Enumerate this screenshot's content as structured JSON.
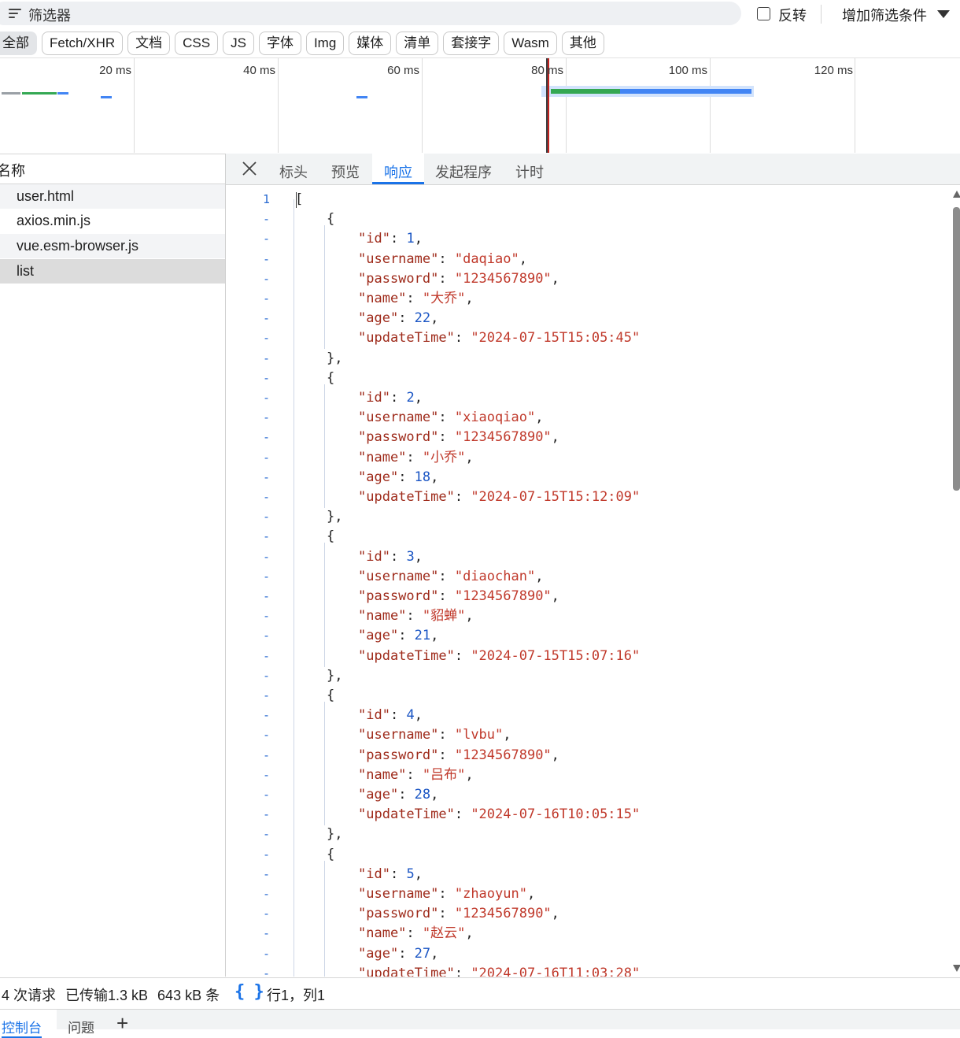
{
  "filter": {
    "placeholder": "筛选器",
    "invert_label": "反转",
    "add_filter_label": "增加筛选条件"
  },
  "type_chips": [
    "全部",
    "Fetch/XHR",
    "文档",
    "CSS",
    "JS",
    "字体",
    "Img",
    "媒体",
    "清单",
    "套接字",
    "Wasm",
    "其他"
  ],
  "timeline": {
    "ticks": [
      "20 ms",
      "40 ms",
      "60 ms",
      "80 ms",
      "100 ms",
      "120 ms"
    ],
    "colors": {
      "waiting": "#34a853",
      "download": "#4285f4",
      "queued": "#9aa0a6",
      "marker": "#c5221f"
    }
  },
  "requests": {
    "header": "名称",
    "items": [
      "user.html",
      "axios.min.js",
      "vue.esm-browser.js",
      "list"
    ],
    "selected": "list"
  },
  "detail_tabs": {
    "items": [
      "标头",
      "预览",
      "响应",
      "发起程序",
      "计时"
    ],
    "active": "响应"
  },
  "response": {
    "first_line_number": "1",
    "other_line_marker": "-",
    "records": [
      {
        "id": 1,
        "username": "daqiao",
        "password": "1234567890",
        "name": "大乔",
        "age": 22,
        "updateTime": "2024-07-15T15:05:45"
      },
      {
        "id": 2,
        "username": "xiaoqiao",
        "password": "1234567890",
        "name": "小乔",
        "age": 18,
        "updateTime": "2024-07-15T15:12:09"
      },
      {
        "id": 3,
        "username": "diaochan",
        "password": "1234567890",
        "name": "貂蝉",
        "age": 21,
        "updateTime": "2024-07-15T15:07:16"
      },
      {
        "id": 4,
        "username": "lvbu",
        "password": "1234567890",
        "name": "吕布",
        "age": 28,
        "updateTime": "2024-07-16T10:05:15"
      },
      {
        "id": 5,
        "username": "zhaoyun",
        "password": "1234567890",
        "name": "赵云",
        "age": 27,
        "updateTime": "2024-07-16T11:03:28"
      }
    ]
  },
  "status": {
    "requests": "4 次请求",
    "transferred": "已传输1.3 kB",
    "resources": "643 kB 条",
    "format_button": "{ }",
    "cursor": "行1，列1"
  },
  "drawer": {
    "console_tab": "控制台",
    "issues_tab": "问题",
    "add_label": "+"
  }
}
